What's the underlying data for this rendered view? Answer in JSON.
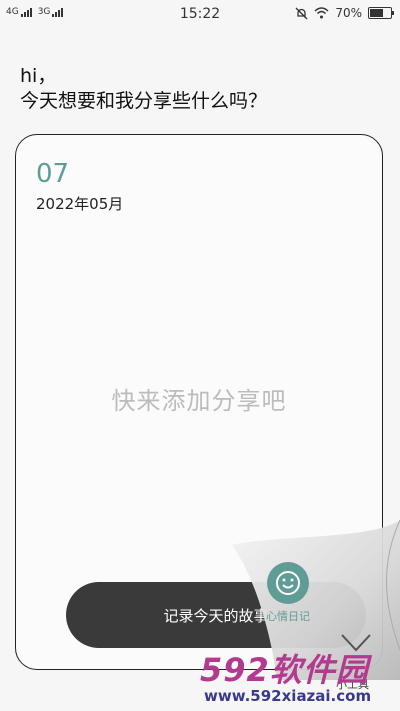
{
  "status": {
    "net1": "4G",
    "net2": "3G",
    "time": "15:22",
    "battery": "70%",
    "battery_level": 0.7
  },
  "greeting": {
    "line1": "hi，",
    "line2": "今天想要和我分享些什么吗？"
  },
  "card": {
    "day": "07",
    "month": "2022年05月",
    "empty_text": "快来添加分享吧"
  },
  "record_button": {
    "label": "记录今天的故事"
  },
  "mood_diary": {
    "label": "心情日记"
  },
  "tool": {
    "label": "小工具"
  },
  "watermark": {
    "big": "592软件园",
    "small": "www.592xiazai.com"
  },
  "colors": {
    "accent": "#5f9c95",
    "button": "#3a3a3a",
    "watermark": "#b23a8f"
  }
}
